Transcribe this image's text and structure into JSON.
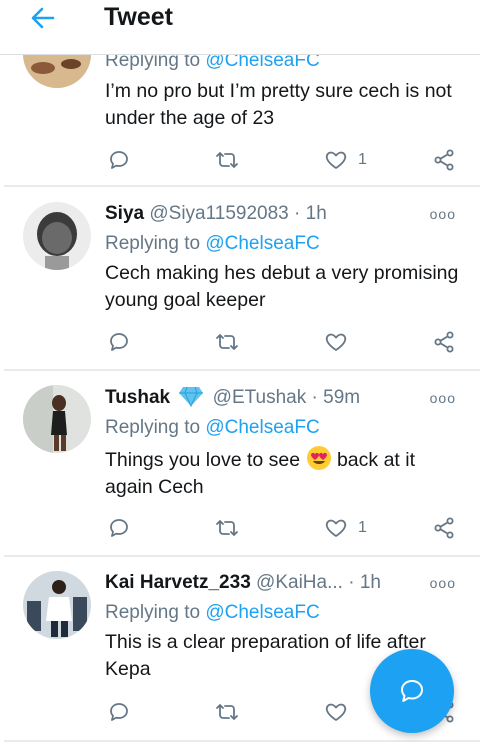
{
  "header": {
    "title": "Tweet",
    "back_icon": "arrow-left-icon"
  },
  "tweets": [
    {
      "name": "",
      "handle": "",
      "time": "",
      "replying_prefix": "Replying to ",
      "replying_to": "@ChelseaFC",
      "text": "I’m no pro but I’m pretty sure cech is not under the age of 23",
      "likes": "1"
    },
    {
      "name": "Siya",
      "handle": "@Siya11592083",
      "dot": "·",
      "time": "1h",
      "replying_prefix": "Replying to ",
      "replying_to": "@ChelseaFC",
      "text": "Cech making hes debut a very promising young goal keeper",
      "likes": ""
    },
    {
      "name": "Tushak",
      "name_badge": "gem-icon",
      "handle": "@ETushak",
      "dot": "·",
      "time": "59m",
      "replying_prefix": "Replying to ",
      "replying_to": "@ChelseaFC",
      "text_before": "Things you love to see ",
      "emoji": "heart-eyes-emoji",
      "text_after": " back at it again Cech",
      "likes": "1"
    },
    {
      "name": "Kai Harvetz_233",
      "handle": "@KaiHa...",
      "dot": "·",
      "time": "1h",
      "replying_prefix": "Replying to ",
      "replying_to": "@ChelseaFC",
      "text": "This is a clear preparation of life after Kepa",
      "likes": ""
    }
  ],
  "more_label": "ooo",
  "fab_icon": "compose-reply-icon",
  "colors": {
    "accent": "#1da1f2",
    "muted": "#657786",
    "text": "#14171a",
    "divider": "#e6ecf0"
  }
}
